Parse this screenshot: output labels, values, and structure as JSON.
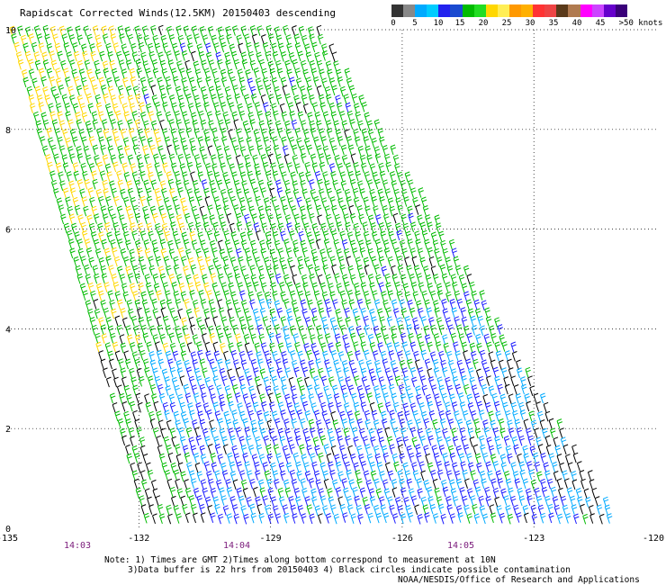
{
  "title": "Rapidscat Corrected Winds(12.5KM) 20150403 descending",
  "legend": {
    "colors": [
      "#333333",
      "#888888",
      "#00aaff",
      "#00ccff",
      "#2222ee",
      "#1a4ad0",
      "#00bb00",
      "#22dd22",
      "#ffd700",
      "#ffee55",
      "#ff9900",
      "#ffb000",
      "#ff3333",
      "#ee4444",
      "#5a3a1a",
      "#b07a50",
      "#ff00ff",
      "#cc44ff",
      "#6600cc",
      "#3a007a"
    ],
    "labels": [
      "0",
      "5",
      "10",
      "15",
      "20",
      "25",
      "30",
      "35",
      "40",
      "45",
      ">50 knots"
    ],
    "colors_by_bin": {
      "calm": "#000000",
      "light": "#1a1aff",
      "moderate": "#00aaff",
      "fresh": "#00bb00",
      "strong": "#ffd700",
      "gale": "#ff3333"
    }
  },
  "axes": {
    "lat_labels": [
      "0",
      "2",
      "4",
      "6",
      "8",
      "10"
    ],
    "lon_labels": [
      "-135",
      "-132",
      "-129",
      "-126",
      "-123",
      "-120"
    ],
    "time_labels": [
      "14:03",
      "14:04",
      "14:05"
    ]
  },
  "notes": {
    "line1": "Note: 1) Times are GMT 2)Times along bottom correspond to measurement at 10N",
    "line2": "3)Data buffer is 22 hrs from 20150403 4) Black circles indicate possible contamination",
    "line3": "NOAA/NESDIS/Office of Research and Applications"
  }
}
